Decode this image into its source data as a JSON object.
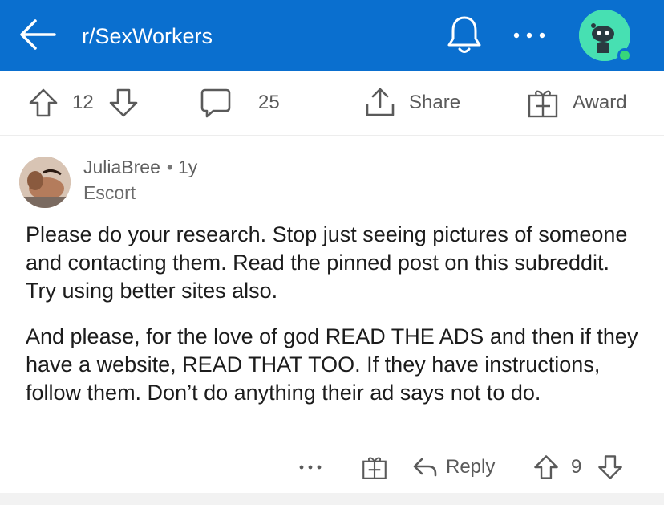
{
  "header": {
    "subreddit": "r/SexWorkers",
    "back_icon": "arrow-left-icon",
    "bell_icon": "bell-icon",
    "more_icon": "more-horizontal-icon",
    "avatar_icon": "snoo-avatar-icon",
    "bg_color": "#0a6fcf"
  },
  "post_actions": {
    "upvotes": "12",
    "comments": "25",
    "share_label": "Share",
    "award_label": "Award"
  },
  "comment": {
    "username": "JuliaBree",
    "age": "1y",
    "flair": "Escort",
    "paragraphs": [
      "Please do your research. Stop just seeing pictures of someone and contacting them. Read the pinned post on this subreddit. Try using better sites also.",
      "And please, for the love of god READ THE ADS and then if they have a website, READ THAT TOO. If they have instructions, follow them. Don’t do anything their ad says not to do."
    ],
    "reply_label": "Reply",
    "score": "9"
  }
}
